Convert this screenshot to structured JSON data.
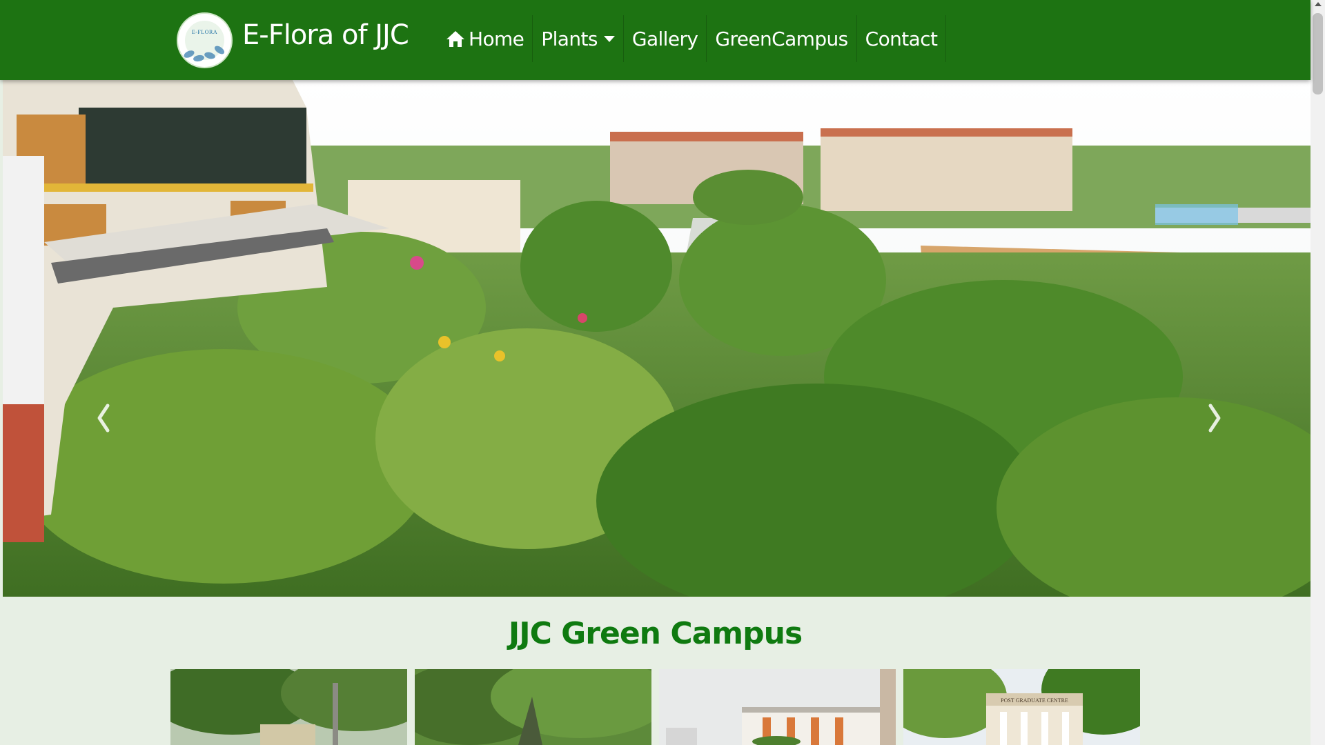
{
  "brand": {
    "title": "E-Flora of JJC",
    "logo_text": "E-FLORA"
  },
  "nav": {
    "items": [
      {
        "label": "Home",
        "icon": "home-icon"
      },
      {
        "label": "Plants",
        "icon": "caret-down-icon"
      },
      {
        "label": "Gallery"
      },
      {
        "label": "GreenCampus"
      },
      {
        "label": "Contact"
      }
    ]
  },
  "carousel": {
    "prev_icon": "chevron-left-icon",
    "next_icon": "chevron-right-icon",
    "building_sign": "POST GRADUATE CENTRE"
  },
  "section": {
    "title": "JJC Green Campus"
  },
  "colors": {
    "navbar": "#1d7312",
    "page_background": "#e7efe4",
    "section_title": "#0f7a10"
  }
}
